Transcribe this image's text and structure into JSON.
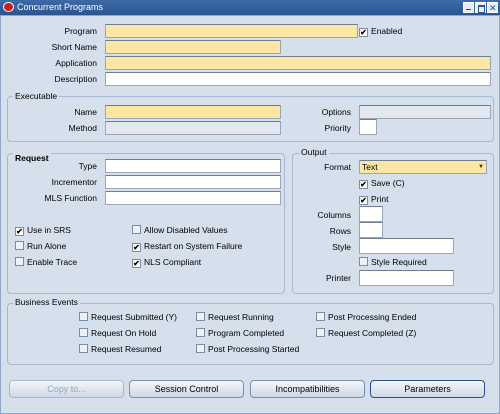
{
  "window": {
    "title": "Concurrent Programs"
  },
  "main": {
    "program_label": "Program",
    "program_value": "",
    "enabled_label": "Enabled",
    "enabled_checked": true,
    "short_name_label": "Short Name",
    "short_name_value": "",
    "application_label": "Application",
    "application_value": "",
    "description_label": "Description",
    "description_value": ""
  },
  "executable": {
    "title": "Executable",
    "name_label": "Name",
    "name_value": "",
    "method_label": "Method",
    "method_value": "",
    "options_label": "Options",
    "options_value": "",
    "priority_label": "Priority",
    "priority_value": ""
  },
  "request": {
    "title": "Request",
    "type_label": "Type",
    "type_value": "",
    "incrementor_label": "Incrementor",
    "incrementor_value": "",
    "mls_label": "MLS Function",
    "mls_value": "",
    "checkboxes": [
      {
        "label": "Use in SRS",
        "checked": true
      },
      {
        "label": "Allow Disabled Values",
        "checked": false
      },
      {
        "label": "Run Alone",
        "checked": false
      },
      {
        "label": "Restart on System Failure",
        "checked": true
      },
      {
        "label": "Enable Trace",
        "checked": false
      },
      {
        "label": "NLS Compliant",
        "checked": true
      }
    ]
  },
  "output": {
    "title": "Output",
    "format_label": "Format",
    "format_value": "Text",
    "save_label": "Save (C)",
    "save_checked": true,
    "print_label": "Print",
    "print_checked": true,
    "columns_label": "Columns",
    "columns_value": "",
    "rows_label": "Rows",
    "rows_value": "",
    "style_label": "Style",
    "style_value": "",
    "style_required_label": "Style Required",
    "style_required_checked": false,
    "printer_label": "Printer",
    "printer_value": ""
  },
  "business_events": {
    "title": "Business Events",
    "items": [
      {
        "label": "Request Submitted (Y)",
        "checked": false
      },
      {
        "label": "Request Running",
        "checked": false
      },
      {
        "label": "Post Processing Ended",
        "checked": false
      },
      {
        "label": "Request On Hold",
        "checked": false
      },
      {
        "label": "Program Completed",
        "checked": false
      },
      {
        "label": "Request Completed (Z)",
        "checked": false
      },
      {
        "label": "Request Resumed",
        "checked": false
      },
      {
        "label": "Post Processing Started",
        "checked": false
      }
    ]
  },
  "buttons": {
    "copy_to": "Copy to...",
    "session_control": "Session Control",
    "incompatibilities": "Incompatibilities",
    "parameters": "Parameters"
  }
}
